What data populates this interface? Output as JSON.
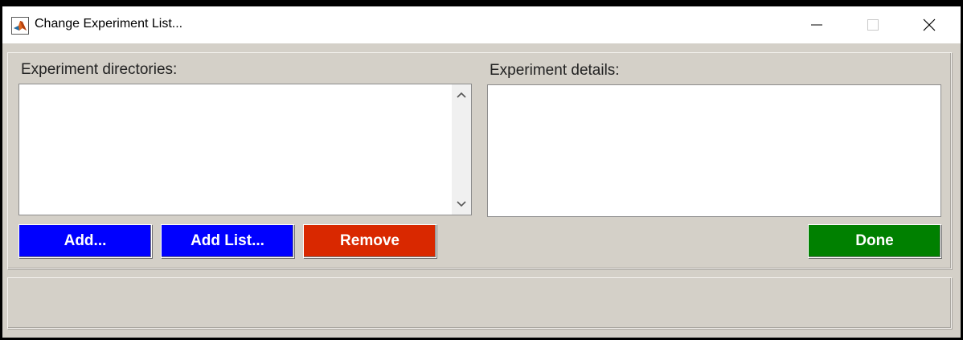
{
  "window": {
    "title": "Change Experiment List..."
  },
  "left": {
    "label": "Experiment directories:"
  },
  "right": {
    "label": "Experiment details:"
  },
  "buttons": {
    "add": "Add...",
    "add_list": "Add List...",
    "remove": "Remove",
    "done": "Done"
  },
  "colors": {
    "add": "#0000ff",
    "add_list": "#0000ff",
    "remove": "#d92800",
    "done": "#008000",
    "background": "#d4d0c8"
  },
  "icons": {
    "app": "matlab-logo-icon",
    "minimize": "minimize-icon",
    "maximize": "maximize-icon",
    "close": "close-icon",
    "scroll_up": "chevron-up-icon",
    "scroll_down": "chevron-down-icon"
  }
}
